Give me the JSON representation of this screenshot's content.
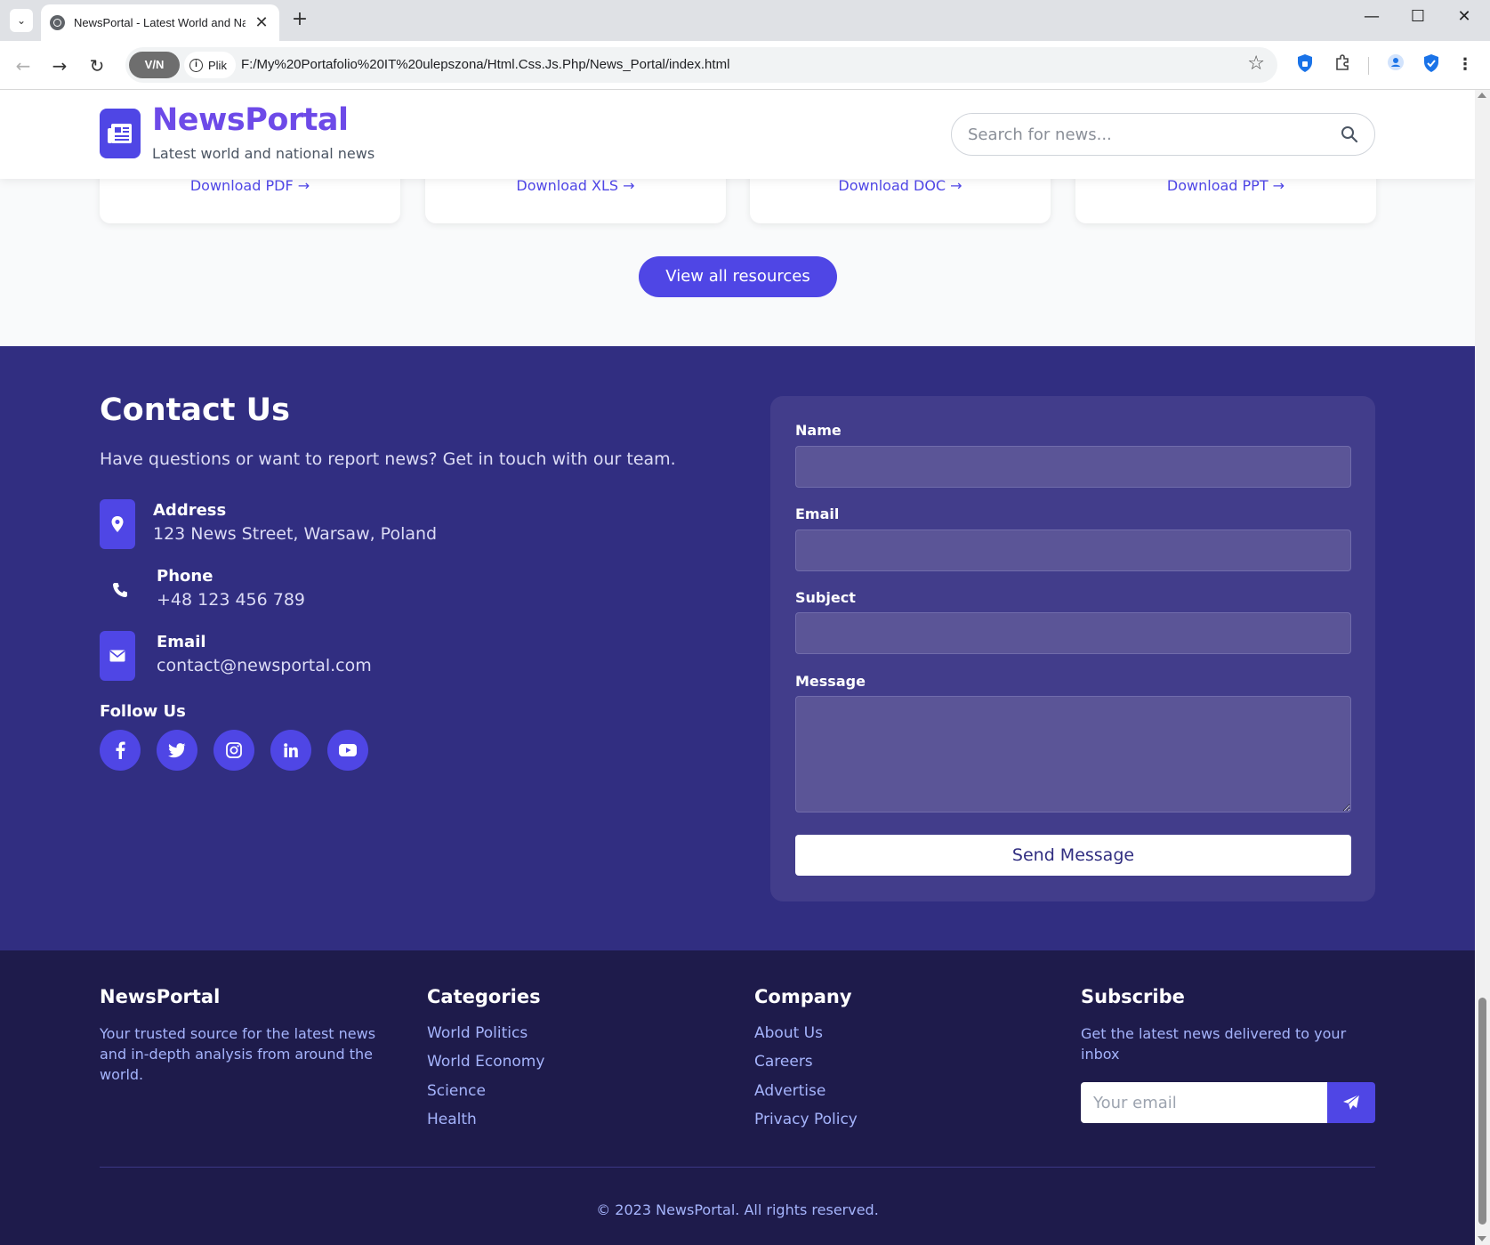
{
  "browser": {
    "tab_title": "NewsPortal - Latest World and Nat",
    "security_label": "Plik",
    "vpn_label": "V/N",
    "url": "F:/My%20Portafolio%20IT%20ulepszona/Html.Css.Js.Php/News_Portal/index.html"
  },
  "header": {
    "logo_title": "NewsPortal",
    "tagline": "Latest world and national news",
    "search_placeholder": "Search for news..."
  },
  "resources": {
    "links": [
      "Download PDF →",
      "Download XLS →",
      "Download DOC →",
      "Download PPT →"
    ],
    "view_all": "View all resources"
  },
  "contact": {
    "title": "Contact Us",
    "subtitle": "Have questions or want to report news? Get in touch with our team.",
    "items": [
      {
        "label": "Address",
        "value": "123 News Street, Warsaw, Poland",
        "icon": "map-pin-icon"
      },
      {
        "label": "Phone",
        "value": "+48 123 456 789",
        "icon": "phone-icon"
      },
      {
        "label": "Email",
        "value": "contact@newsportal.com",
        "icon": "envelope-icon"
      }
    ],
    "follow_title": "Follow Us",
    "socials": [
      "facebook-icon",
      "twitter-icon",
      "instagram-icon",
      "linkedin-icon",
      "youtube-icon"
    ],
    "form": {
      "name_label": "Name",
      "email_label": "Email",
      "subject_label": "Subject",
      "message_label": "Message",
      "send_label": "Send Message"
    }
  },
  "footer": {
    "brand_title": "NewsPortal",
    "brand_text": "Your trusted source for the latest news and in-depth analysis from around the world.",
    "categories_title": "Categories",
    "categories": [
      "World Politics",
      "World Economy",
      "Science",
      "Health"
    ],
    "company_title": "Company",
    "company": [
      "About Us",
      "Careers",
      "Advertise",
      "Privacy Policy"
    ],
    "subscribe_title": "Subscribe",
    "subscribe_text": "Get the latest news delivered to your inbox",
    "email_placeholder": "Your email",
    "copyright": "© 2023 NewsPortal. All rights reserved."
  },
  "colors": {
    "primary": "#4f46e5",
    "contact_bg": "#312e81",
    "footer_bg": "#1e1b4b",
    "link_light": "#a5b4fc"
  }
}
